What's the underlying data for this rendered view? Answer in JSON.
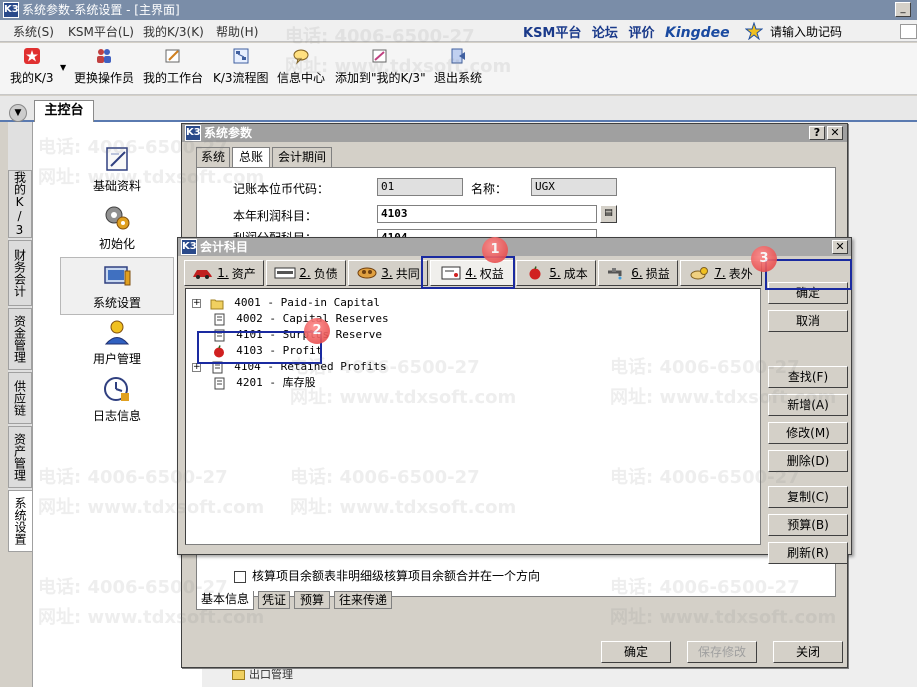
{
  "app": {
    "title": "系统参数-系统设置 - [主界面]",
    "logo": "K3"
  },
  "menu": {
    "items": [
      "系统(S)",
      "KSM平台(L)",
      "我的K/3(K)",
      "帮助(H)"
    ],
    "brand_links": [
      "KSM平台",
      "论坛",
      "评价"
    ],
    "brand": "Kingdee",
    "helper_label": "请输入助记码"
  },
  "toolbar": {
    "items": [
      "我的K/3",
      "更换操作员",
      "我的工作台",
      "K/3流程图",
      "信息中心",
      "添加到\"我的K/3\"",
      "退出系统"
    ]
  },
  "tabs": {
    "main": "主控台"
  },
  "leftnav": {
    "items": [
      "我的K/3",
      "财务会计",
      "资金管理",
      "供应链",
      "资产管理",
      "系统设置"
    ]
  },
  "sidebar": {
    "items": [
      "基础资料",
      "初始化",
      "系统设置",
      "用户管理",
      "日志信息"
    ],
    "selected": "系统设置"
  },
  "watermark": {
    "phone": "电话: 4006-6500-27",
    "site": "网址: www.tdxsoft.com"
  },
  "sys_dialog": {
    "title": "系统参数",
    "tabs": [
      "系统",
      "总账",
      "会计期间"
    ],
    "active_tab": "总账",
    "currency_label": "记账本位币代码：",
    "currency_code": "01",
    "name_label": "名称：",
    "name_value": "UGX",
    "profit_label": "本年利润科目：",
    "profit_value": "4103",
    "dist_label": "利润分配科目：",
    "dist_value": "4104",
    "checkbox_label": "核算项目余额表非明细级核算项目余额合并在一个方向",
    "bottom_tabs": [
      "基本信息",
      "凭证",
      "预算",
      "往来传递"
    ],
    "buttons": {
      "ok": "确定",
      "save": "保存修改",
      "close": "关闭"
    }
  },
  "acct_dialog": {
    "title": "会计科目",
    "tabs": [
      {
        "num": "1.",
        "label": "资产"
      },
      {
        "num": "2.",
        "label": "负债"
      },
      {
        "num": "3.",
        "label": "共同"
      },
      {
        "num": "4.",
        "label": "权益"
      },
      {
        "num": "5.",
        "label": "成本"
      },
      {
        "num": "6.",
        "label": "损益"
      },
      {
        "num": "7.",
        "label": "表外"
      }
    ],
    "active_tab": "权益",
    "tree": [
      {
        "code": "4001",
        "name": "Paid-in Capital",
        "type": "folder",
        "expandable": true
      },
      {
        "code": "4002",
        "name": "Capital Reserves",
        "type": "doc",
        "expandable": false
      },
      {
        "code": "4101",
        "name": "Surplus Reserve",
        "type": "doc",
        "expandable": false
      },
      {
        "code": "4103",
        "name": "Profit",
        "type": "selected",
        "expandable": false
      },
      {
        "code": "4104",
        "name": "Retained Profits",
        "type": "doc",
        "expandable": true
      },
      {
        "code": "4201",
        "name": "库存股",
        "type": "doc",
        "expandable": false
      }
    ],
    "buttons": [
      "确定",
      "取消",
      "查找(F)",
      "新增(A)",
      "修改(M)",
      "删除(D)",
      "复制(C)",
      "预算(B)",
      "刷新(R)"
    ]
  },
  "annotations": [
    "1",
    "2",
    "3"
  ],
  "partial_text": "出口管理"
}
